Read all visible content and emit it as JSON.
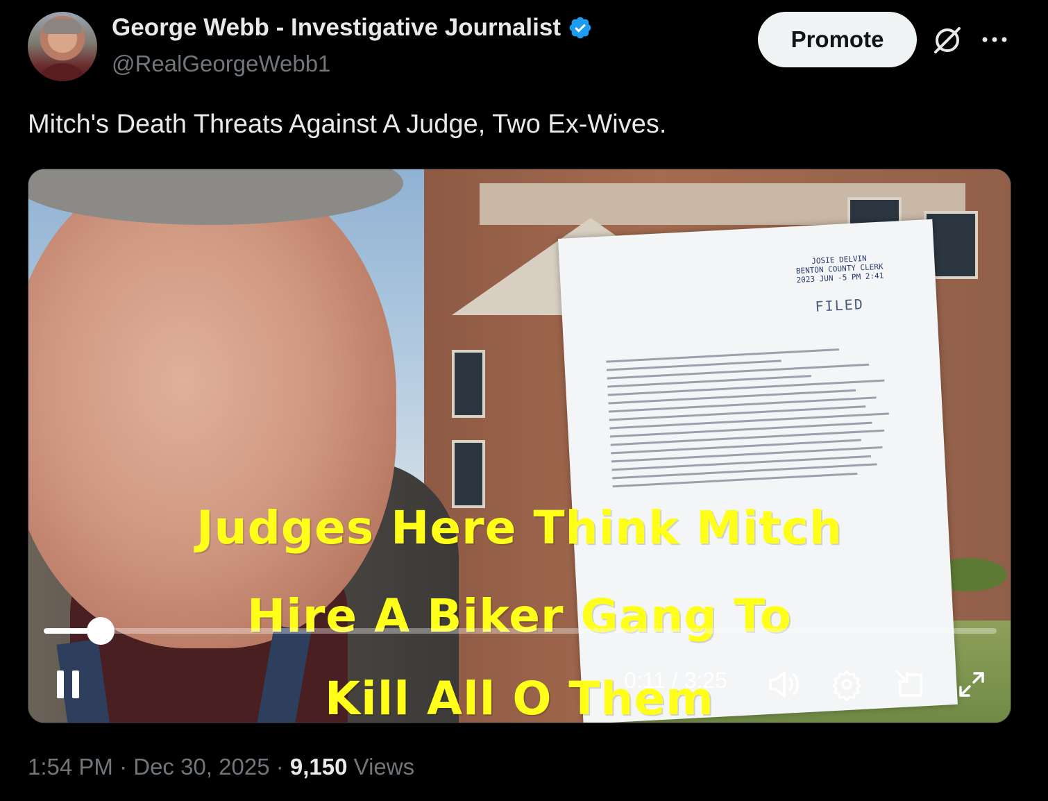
{
  "author": {
    "name": "George Webb - Investigative Journalist",
    "handle": "@RealGeorgeWebb1",
    "verified": true
  },
  "header": {
    "promote_label": "Promote"
  },
  "tweet": {
    "text": "Mitch's Death Threats Against A Judge, Two Ex-Wives."
  },
  "video": {
    "overlay_lines": [
      "Judges Here Think Mitch",
      "Hire A Biker Gang To",
      "Kill All O Them"
    ],
    "time": "0:11 / 3:25",
    "progress_fraction": 0.06,
    "document": {
      "stamp_lines": [
        "JOSIE DELVIN",
        "BENTON COUNTY CLERK",
        "2023 JUN -5 PM 2:41"
      ],
      "filed": "FILED"
    },
    "controls": [
      "pause-icon",
      "volume-icon",
      "settings-icon",
      "pip-icon",
      "fullscreen-icon"
    ]
  },
  "meta": {
    "time": "1:54 PM",
    "date": "Dec 30, 2025",
    "views_count": "9,150",
    "views_label": "Views",
    "separator": "·"
  },
  "colors": {
    "background": "#000000",
    "text_primary": "#e7e9ea",
    "text_secondary": "#71767b",
    "verified_badge": "#1d9bf0",
    "overlay_text": "#ffff1a"
  }
}
